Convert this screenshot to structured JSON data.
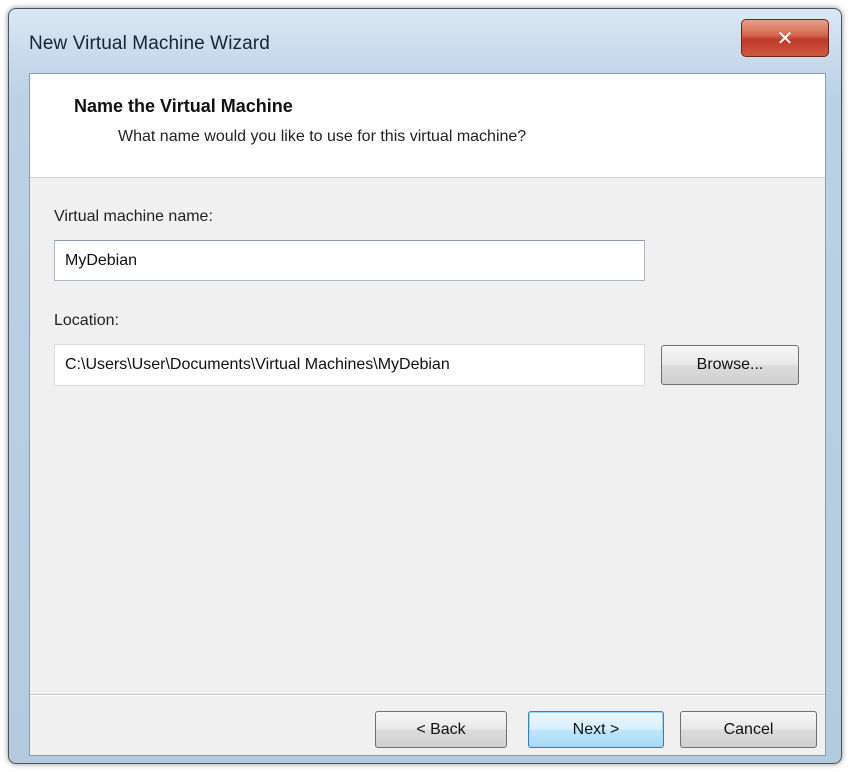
{
  "window": {
    "title": "New Virtual Machine Wizard",
    "close_symbol": "✕"
  },
  "header": {
    "title": "Name the Virtual Machine",
    "subtitle": "What name would you like to use for this virtual machine?"
  },
  "form": {
    "name_label": "Virtual machine name:",
    "name_value": "MyDebian",
    "location_label": "Location:",
    "location_value": "C:\\Users\\User\\Documents\\Virtual Machines\\MyDebian",
    "browse_label": "Browse..."
  },
  "footer": {
    "back_label": "< Back",
    "next_label": "Next >",
    "cancel_label": "Cancel"
  },
  "icons": {
    "close": "close-icon"
  },
  "colors": {
    "close_button": "#c0392b",
    "default_button_border": "#3c7fb1",
    "frame": "#b3cadf"
  }
}
